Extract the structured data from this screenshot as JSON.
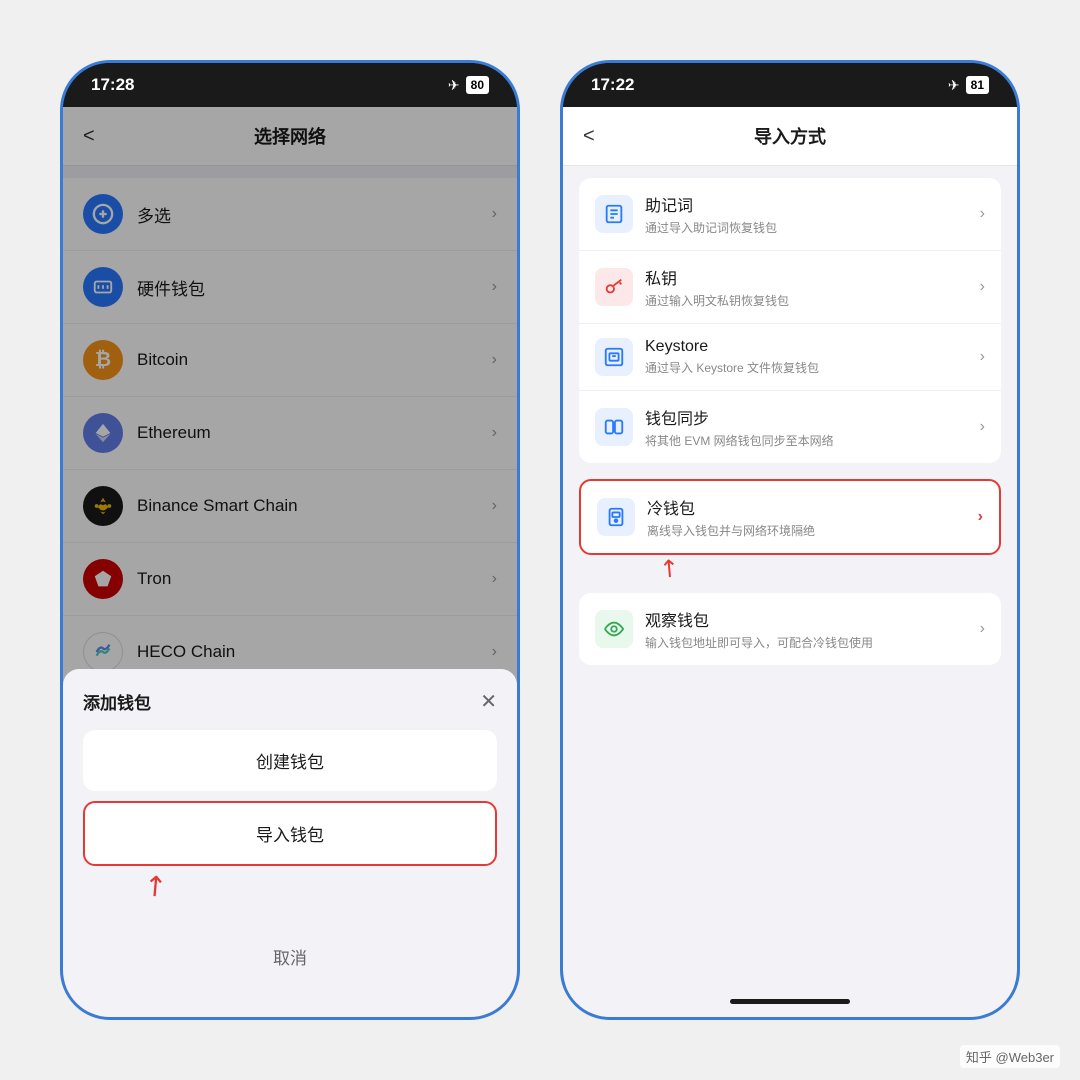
{
  "left_phone": {
    "status_time": "17:28",
    "battery": "80",
    "title": "选择网络",
    "back": "<",
    "networks": [
      {
        "id": "multiselect",
        "name": "多选",
        "icon_type": "multiselect"
      },
      {
        "id": "hardware",
        "name": "硬件钱包",
        "icon_type": "hardware"
      },
      {
        "id": "bitcoin",
        "name": "Bitcoin",
        "icon_type": "bitcoin"
      },
      {
        "id": "ethereum",
        "name": "Ethereum",
        "icon_type": "ethereum"
      },
      {
        "id": "bnb",
        "name": "Binance Smart Chain",
        "icon_type": "bnb"
      },
      {
        "id": "tron",
        "name": "Tron",
        "icon_type": "tron"
      },
      {
        "id": "heco",
        "name": "HECO Chain",
        "icon_type": "heco"
      }
    ],
    "sheet": {
      "title": "添加钱包",
      "create": "创建钱包",
      "import": "导入钱包",
      "cancel": "取消"
    }
  },
  "right_phone": {
    "status_time": "17:22",
    "battery": "81",
    "title": "导入方式",
    "back": "<",
    "groups": [
      {
        "items": [
          {
            "id": "mnemonic",
            "name": "助记词",
            "desc": "通过导入助记词恢复钱包",
            "icon_type": "mnemonic"
          },
          {
            "id": "privatekey",
            "name": "私钥",
            "desc": "通过输入明文私钥恢复钱包",
            "icon_type": "privatekey"
          },
          {
            "id": "keystore",
            "name": "Keystore",
            "desc": "通过导入 Keystore 文件恢复钱包",
            "icon_type": "keystore"
          },
          {
            "id": "walletsync",
            "name": "钱包同步",
            "desc": "将其他 EVM 网络钱包同步至本网络",
            "icon_type": "walletsync"
          }
        ]
      }
    ],
    "highlighted_item": {
      "id": "coldwallet",
      "name": "冷钱包",
      "desc": "离线导入钱包并与网络环境隔绝",
      "icon_type": "coldwallet"
    },
    "last_item": {
      "id": "watchonly",
      "name": "观察钱包",
      "desc": "输入钱包地址即可导入，可配合冷钱包使用",
      "icon_type": "watchonly"
    }
  },
  "watermark": "知乎 @Web3er"
}
